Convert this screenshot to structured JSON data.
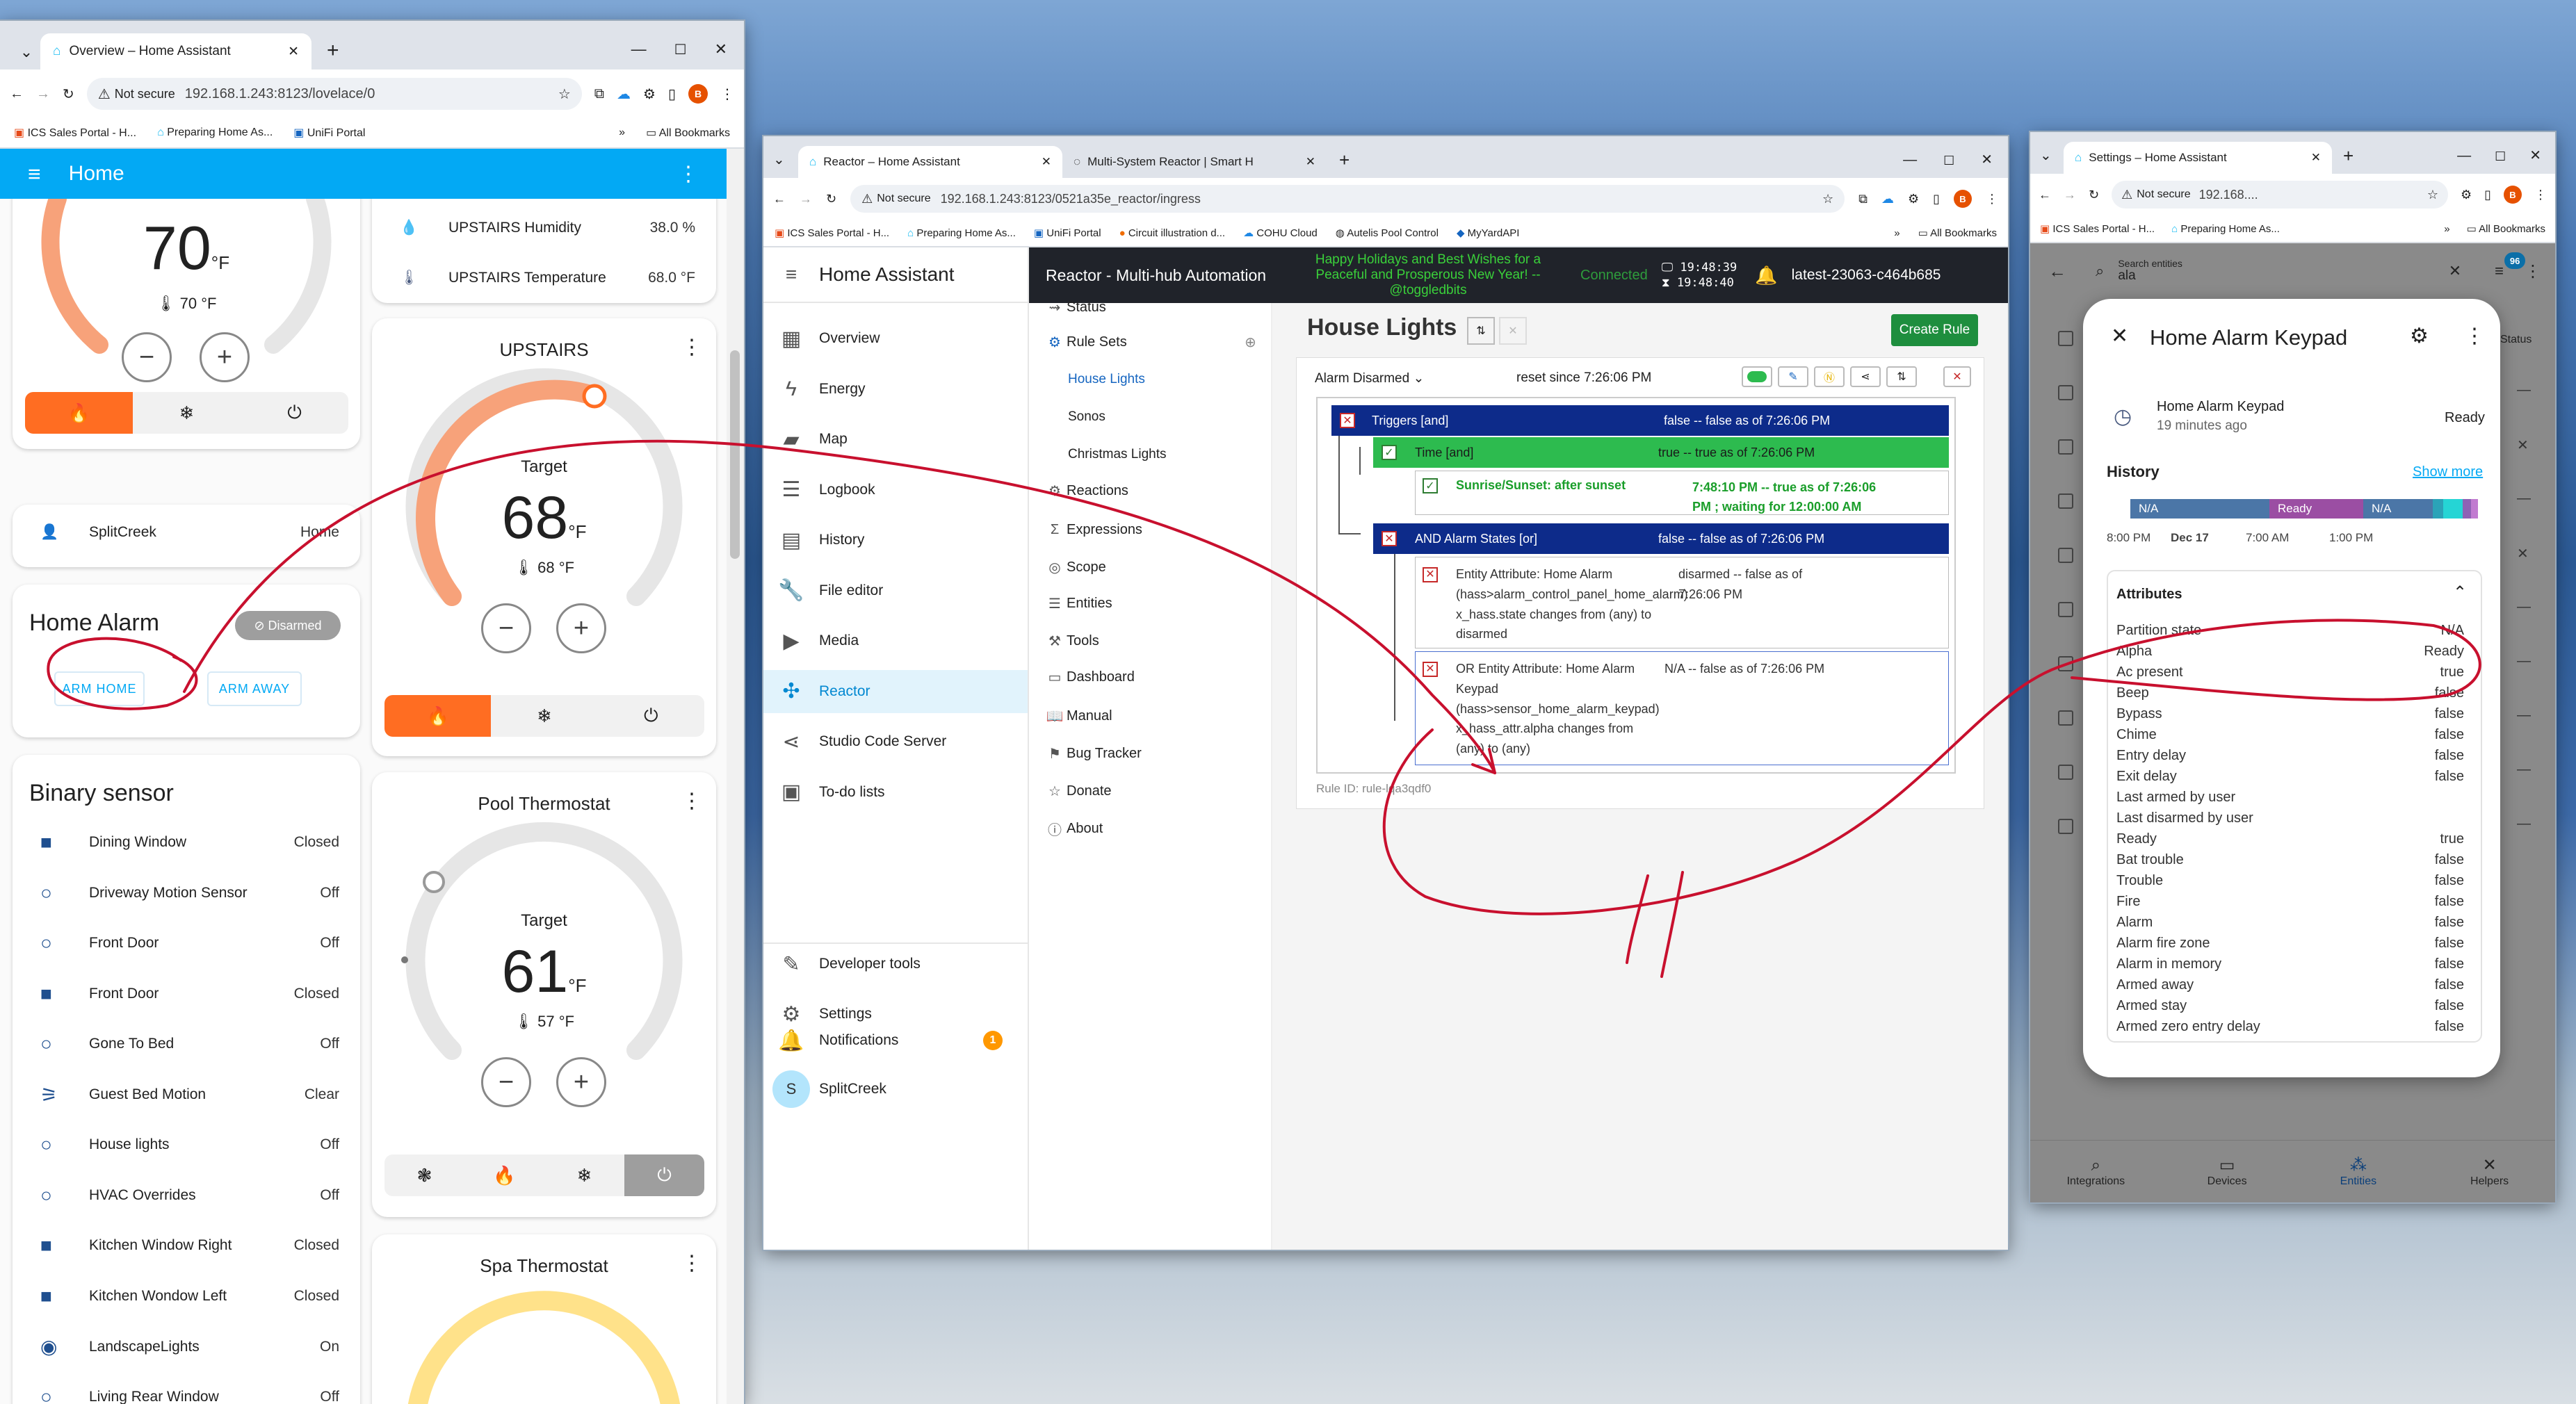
{
  "win1": {
    "tab_title": "Overview – Home Assistant",
    "url_secure": "Not secure",
    "url": "192.168.1.243:8123/lovelace/0",
    "bookmarks": [
      "ICS Sales Portal - H...",
      "Preparing Home As...",
      "UniFi Portal"
    ],
    "all_bookmarks": "All Bookmarks",
    "header_title": "Home",
    "thermo1": {
      "temp": "70",
      "unit": "°F",
      "current": "70 °F"
    },
    "sensors": [
      {
        "name": "UPSTAIRS Humidity",
        "value": "38.0 %"
      },
      {
        "name": "UPSTAIRS Temperature",
        "value": "68.0 °F"
      }
    ],
    "person": {
      "name": "SplitCreek",
      "state": "Home"
    },
    "alarm": {
      "title": "Home Alarm",
      "state": "Disarmed",
      "arm_home": "ARM HOME",
      "arm_away": "ARM AWAY"
    },
    "upstairs": {
      "title": "UPSTAIRS",
      "target_label": "Target",
      "temp": "68",
      "unit": "°F",
      "current": "68 °F"
    },
    "pool": {
      "title": "Pool Thermostat",
      "target_label": "Target",
      "temp": "61",
      "unit": "°F",
      "current": "57 °F"
    },
    "spa": {
      "title": "Spa Thermostat"
    },
    "binary_title": "Binary sensor",
    "binary": [
      {
        "name": "Dining Window",
        "value": "Closed",
        "icon": "square"
      },
      {
        "name": "Driveway Motion Sensor",
        "value": "Off",
        "icon": "circle"
      },
      {
        "name": "Front Door",
        "value": "Off",
        "icon": "circle"
      },
      {
        "name": "Front Door",
        "value": "Closed",
        "icon": "square"
      },
      {
        "name": "Gone To Bed",
        "value": "Off",
        "icon": "circle"
      },
      {
        "name": "Guest Bed Motion",
        "value": "Clear",
        "icon": "motion"
      },
      {
        "name": "House lights",
        "value": "Off",
        "icon": "circle"
      },
      {
        "name": "HVAC Overrides",
        "value": "Off",
        "icon": "circle"
      },
      {
        "name": "Kitchen Window Right",
        "value": "Closed",
        "icon": "square"
      },
      {
        "name": "Kitchen Wondow Left",
        "value": "Closed",
        "icon": "square"
      },
      {
        "name": "LandscapeLights",
        "value": "On",
        "icon": "check"
      },
      {
        "name": "Living Rear Window",
        "value": "Off",
        "icon": "circle"
      }
    ]
  },
  "win2": {
    "tab1": "Reactor – Home Assistant",
    "tab2": "Multi-System Reactor | Smart H",
    "url_secure": "Not secure",
    "url": "192.168.1.243:8123/0521a35e_reactor/ingress",
    "bookmarks": [
      "ICS Sales Portal - H...",
      "Preparing Home As...",
      "UniFi Portal",
      "Circuit illustration d...",
      "COHU Cloud",
      "Autelis Pool Control",
      "MyYardAPI"
    ],
    "all_bookmarks": "All Bookmarks",
    "app_title": "Home Assistant",
    "nav": [
      "Overview",
      "Energy",
      "Map",
      "Logbook",
      "History",
      "File editor",
      "Media",
      "Reactor",
      "Studio Code Server",
      "To-do lists"
    ],
    "nav_bottom": [
      "Developer tools",
      "Settings"
    ],
    "notifications": "Notifications",
    "notif_count": "1",
    "user_initial": "S",
    "user": "SplitCreek",
    "reactor_title": "Reactor - Multi-hub Automation",
    "holiday": [
      "Happy Holidays and Best Wishes for a",
      "Peaceful and Prosperous New Year! --",
      "@toggledbits"
    ],
    "connected": "Connected",
    "time1": "19:48:39",
    "time2": "19:48:40",
    "version": "latest-23063-c464b685",
    "subnav": [
      "Status",
      "Rule Sets",
      "House Lights",
      "Sonos",
      "Christmas Lights",
      "Reactions",
      "Expressions",
      "Scope",
      "Entities",
      "Tools",
      "Dashboard",
      "Manual",
      "Bug Tracker",
      "Donate",
      "About"
    ],
    "ruleset_title": "House Lights",
    "create_rule": "Create Rule",
    "rule_name": "Alarm Disarmed",
    "rule_reset": "reset since 7:26:06 PM",
    "triggers_label": "Triggers [and]",
    "triggers_state": "false -- false as of 7:26:06 PM",
    "time_label": "Time [and]",
    "time_state": "true -- true as of 7:26:06 PM",
    "sun_label": "Sunrise/Sunset: after sunset",
    "sun_state": [
      "7:48:10 PM -- true as of 7:26:06",
      "PM ; waiting for 12:00:00 AM"
    ],
    "and_label": "AND Alarm States [or]",
    "and_state": "false -- false as of 7:26:06 PM",
    "ent1": [
      "Entity Attribute: Home Alarm",
      "(hass>alarm_control_panel_home_alarm)",
      "x_hass.state changes from (any) to",
      "disarmed"
    ],
    "ent1_state": [
      "disarmed -- false as of",
      "7:26:06 PM"
    ],
    "ent2": [
      "OR Entity Attribute: Home Alarm",
      "Keypad",
      "(hass>sensor_home_alarm_keypad)",
      "x_hass_attr.alpha changes from",
      "(any) to (any)"
    ],
    "ent2_state": "N/A -- false as of 7:26:06 PM",
    "rule_id": "Rule ID: rule-lqa3qdf0"
  },
  "win3": {
    "tab_title": "Settings – Home Assistant",
    "url_secure": "Not secure",
    "url": "192.168....",
    "bookmarks": [
      "ICS Sales Portal - H...",
      "Preparing Home As..."
    ],
    "all_bookmarks": "All Bookmarks",
    "search_label": "Search entities",
    "search_value": "ala",
    "status_col": "Status",
    "header_badge": "96",
    "dialog_title": "Home Alarm Keypad",
    "entity_name": "Home Alarm Keypad",
    "entity_ago": "19 minutes ago",
    "entity_state": "Ready",
    "history_label": "History",
    "show_more": "Show more",
    "hist_segments": [
      "N/A",
      "Ready",
      "N/A"
    ],
    "hist_ticks": [
      "8:00 PM",
      "Dec 17",
      "7:00 AM",
      "1:00 PM"
    ],
    "attributes_label": "Attributes",
    "attributes": [
      {
        "k": "Partition state",
        "v": "N/A"
      },
      {
        "k": "Alpha",
        "v": "Ready"
      },
      {
        "k": "Ac present",
        "v": "true"
      },
      {
        "k": "Beep",
        "v": "false"
      },
      {
        "k": "Bypass",
        "v": "false"
      },
      {
        "k": "Chime",
        "v": "false"
      },
      {
        "k": "Entry delay",
        "v": "false"
      },
      {
        "k": "Exit delay",
        "v": "false"
      },
      {
        "k": "Last armed by user",
        "v": ""
      },
      {
        "k": "Last disarmed by user",
        "v": ""
      },
      {
        "k": "Ready",
        "v": "true"
      },
      {
        "k": "Bat trouble",
        "v": "false"
      },
      {
        "k": "Trouble",
        "v": "false"
      },
      {
        "k": "Fire",
        "v": "false"
      },
      {
        "k": "Alarm",
        "v": "false"
      },
      {
        "k": "Alarm fire zone",
        "v": "false"
      },
      {
        "k": "Alarm in memory",
        "v": "false"
      },
      {
        "k": "Armed away",
        "v": "false"
      },
      {
        "k": "Armed stay",
        "v": "false"
      },
      {
        "k": "Armed zero entry delay",
        "v": "false"
      }
    ],
    "bottom_nav": [
      "Integrations",
      "Devices",
      "Entities",
      "Helpers"
    ]
  },
  "colors": {
    "ha_blue": "#03a9f4",
    "orange": "#ff6d22",
    "reactor_dark": "#20232a",
    "navy": "#0d2b8a",
    "green": "#2dbb4f",
    "annot_red": "#c8102e"
  }
}
